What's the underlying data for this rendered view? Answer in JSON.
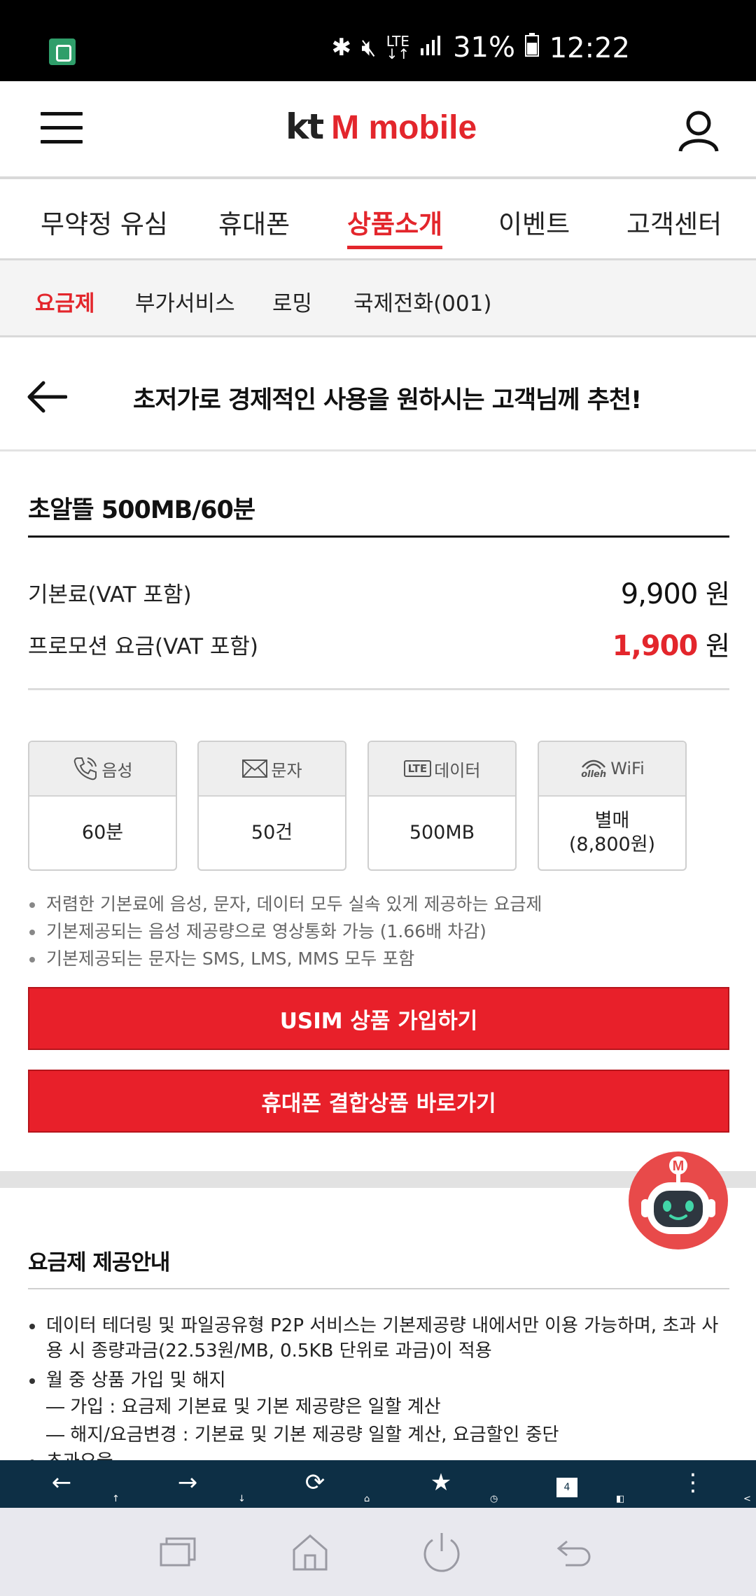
{
  "status_bar": {
    "battery": "31%",
    "time": "12:22",
    "network": "LTE"
  },
  "header": {
    "logo_kt": "kt",
    "logo_rest": "M mobile"
  },
  "main_nav": [
    "무약정 유심",
    "휴대폰",
    "상품소개",
    "이벤트",
    "고객센터"
  ],
  "sub_nav": [
    "요금제",
    "부가서비스",
    "로밍",
    "국제전화(001)"
  ],
  "page": {
    "title": "초저가로 경제적인 사용을 원하시는 고객님께 추천!"
  },
  "plan": {
    "name": "초알뜰 500MB/60분",
    "base_label": "기본료(VAT 포함)",
    "base_value": "9,900",
    "promo_label": "프로모션 요금(VAT 포함)",
    "promo_value": "1,900",
    "unit": "원"
  },
  "cards": [
    {
      "cap": "음성",
      "value": "60분",
      "icon": "phone-icon"
    },
    {
      "cap": "문자",
      "value": "50건",
      "icon": "mail-icon"
    },
    {
      "cap": "데이터",
      "badge": "LTE",
      "value": "500MB",
      "icon": "lte-icon"
    },
    {
      "cap": "WiFi",
      "brand": "olleh",
      "value_line1": "별매",
      "value_line2": "(8,800원)",
      "icon": "wifi-icon"
    }
  ],
  "bullets": [
    "저렴한 기본료에 음성, 문자, 데이터 모두 실속 있게 제공하는 요금제",
    "기본제공되는 음성 제공량으로 영상통화 가능 (1.66배 차감)",
    "기본제공되는 문자는 SMS, LMS, MMS 모두 포함"
  ],
  "buttons": {
    "usim": "USIM 상품 가입하기",
    "phone": "휴대폰 결합상품 바로가기"
  },
  "chatbot": {
    "badge": "M"
  },
  "info": {
    "title": "요금제 제공안내",
    "item1": "데이터 테더링 및 파일공유형 P2P 서비스는 기본제공량 내에서만 이용 가능하며, 초과 사용 시 종량과금(22.53원/MB, 0.5KB 단위로 과금)이 적용",
    "item2": "월 중 상품 가입 및 해지",
    "sub1": "― 가입 : 요금제 기본료 및 기본 제공량은 일할 계산",
    "sub2": "― 해지/요금변경 : 기본료 및 기본 제공량 일할 계산, 요금할인 중단",
    "item3": "초과요율"
  },
  "browser_toolbar": {
    "tab_count": "4"
  }
}
